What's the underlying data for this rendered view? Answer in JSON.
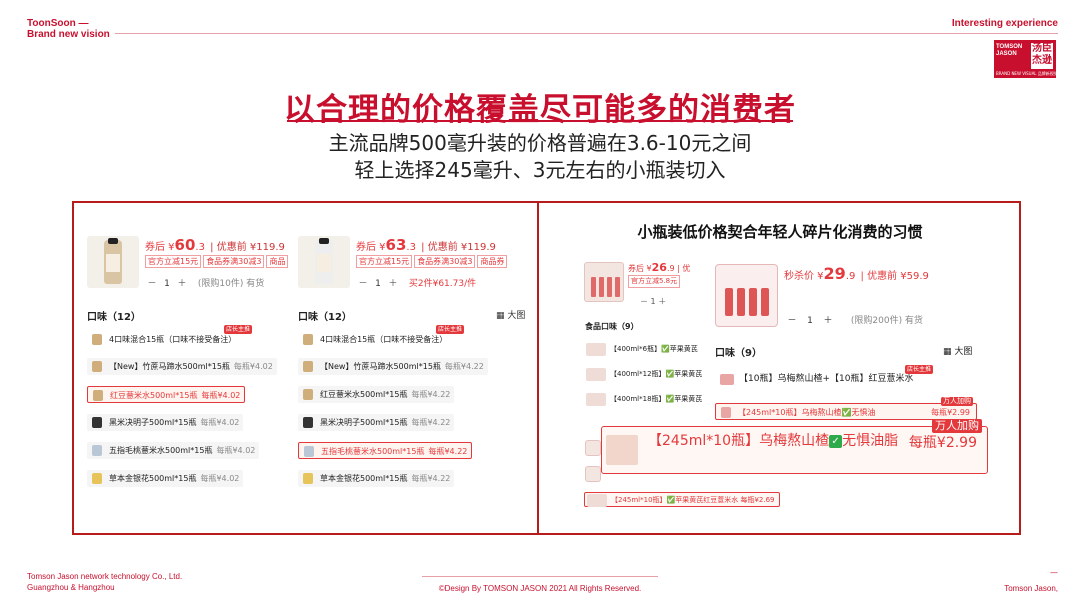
{
  "header": {
    "brand_line1": "ToonSoon —",
    "brand_line2": "Brand new vision",
    "right_text": "Interesting experience",
    "logo_en": "TOMSON\nJASON",
    "logo_cn": "汤臣\n杰逊",
    "logo_tag": "BRAND NEW VISUAL 品牌新视觉"
  },
  "title": "以合理的价格覆盖尽可能多的消费者",
  "subtitle1": "主流品牌500毫升装的价格普遍在3.6-10元之间",
  "subtitle2": "轻上选择245毫升、3元左右的小瓶装切入",
  "left_panels": [
    {
      "price_prefix": "券后 ¥",
      "price_int": "60",
      "price_dec": ".3",
      "price_before": "| 优惠前 ¥119.9",
      "coupons": [
        "官方立减15元",
        "食品券满30减3",
        "商品"
      ],
      "qty_minus": "－",
      "qty": "1",
      "qty_plus": "＋",
      "qty_note": "(限购10件) 有货",
      "flavors_label": "口味（12）",
      "items": [
        {
          "name": "4口味混合15瓶（口味不接受备注）",
          "per": ""
        },
        {
          "name": "【New】竹蔗马蹄水500ml*15瓶",
          "per": "每瓶¥4.02"
        },
        {
          "name": "红豆薏米水500ml*15瓶",
          "per": "每瓶¥4.02"
        },
        {
          "name": "黑米决明子500ml*15瓶",
          "per": "每瓶¥4.02"
        },
        {
          "name": "五指毛桃薏米水500ml*15瓶",
          "per": "每瓶¥4.02"
        },
        {
          "name": "草本金银花500ml*15瓶",
          "per": "每瓶¥4.02"
        }
      ],
      "badge": "店长主推"
    },
    {
      "price_prefix": "券后 ¥",
      "price_int": "63",
      "price_dec": ".3",
      "price_before": "| 优惠前 ¥119.9",
      "coupons": [
        "官方立减15元",
        "食品券满30减3",
        "商品券"
      ],
      "qty_minus": "－",
      "qty": "1",
      "qty_plus": "＋",
      "qty_note": "买2件¥61.73/件",
      "flavors_label": "口味（12）",
      "bigview": "大图",
      "items": [
        {
          "name": "4口味混合15瓶（口味不接受备注）",
          "per": ""
        },
        {
          "name": "【New】竹蔗马蹄水500ml*15瓶",
          "per": "每瓶¥4.22"
        },
        {
          "name": "红豆薏米水500ml*15瓶",
          "per": "每瓶¥4.22"
        },
        {
          "name": "黑米决明子500ml*15瓶",
          "per": "每瓶¥4.22"
        },
        {
          "name": "五指毛桃薏米水500ml*15瓶",
          "per": "每瓶¥4.22"
        },
        {
          "name": "草本金银花500ml*15瓶",
          "per": "每瓶¥4.22"
        }
      ],
      "badge": "店长主推"
    }
  ],
  "right_panel": {
    "title": "小瓶装低价格契合年轻人碎片化消费的习惯",
    "back_price_prefix": "券后 ¥",
    "back_price_int": "26",
    "back_price_dec": ".9",
    "back_price_before": "| 优",
    "back_coupon": "官方立减5.8元",
    "back_flavors": "食品口味（9）",
    "back_items": [
      "【400ml*6瓶】✅苹果黄芪",
      "【400ml*12瓶】✅苹果黄芪",
      "【400ml*18瓶】✅苹果黄芪",
      "【245ml*10瓶】✅苹果黄芪红豆薏米水 每瓶¥2.69"
    ],
    "price_prefix": "秒杀价 ¥",
    "price_int": "29",
    "price_dec": ".9",
    "price_before": "| 优惠前 ¥59.9",
    "qty_minus": "－",
    "qty": "1",
    "qty_plus": "＋",
    "qty_note": "(限购200件) 有货",
    "flavors_label": "口味（9）",
    "bigview": "大图",
    "item1": "【10瓶】乌梅熬山楂+【10瓶】红豆薏米水",
    "item1_badge": "店长主推",
    "item2": "【245ml*10瓶】乌梅熬山楂✅无惧油",
    "item2_per": "每瓶¥2.99",
    "item2_badge": "万人加购",
    "zoom_text": "【245ml*10瓶】乌梅熬山楂",
    "zoom_text2": "无惧油脂",
    "zoom_per": "每瓶¥2.99",
    "zoom_badge": "万人加购"
  },
  "footer": {
    "left1": "Tomson Jason network technology Co., Ltd.",
    "left2": "Guangzhou & Hangzhou",
    "center": "©Design By TOMSON JASON 2021 All Rights Reserved.",
    "right": "Tomson Jason,",
    "dash": "—"
  },
  "colors": {
    "accent": "#c8102e",
    "price": "#e4393c",
    "check": "#2eaa4a"
  }
}
